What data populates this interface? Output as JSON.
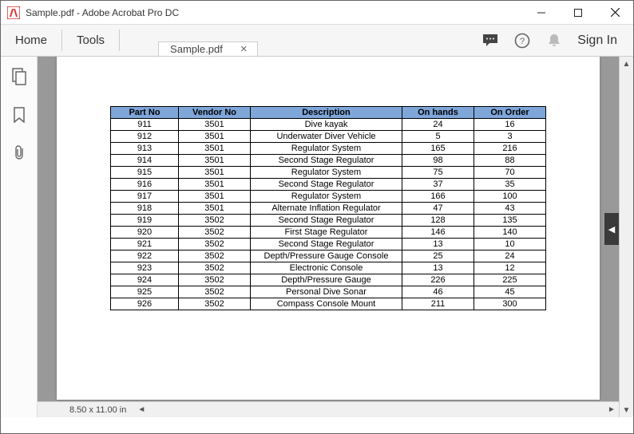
{
  "window": {
    "title": "Sample.pdf - Adobe Acrobat Pro DC"
  },
  "toolbar": {
    "home": "Home",
    "tools": "Tools",
    "tab_label": "Sample.pdf",
    "signin": "Sign In"
  },
  "status": {
    "page_size": "8.50 x 11.00 in"
  },
  "table": {
    "headers": [
      "Part No",
      "Vendor No",
      "Description",
      "On hands",
      "On Order"
    ],
    "rows": [
      [
        "911",
        "3501",
        "Dive kayak",
        "24",
        "16"
      ],
      [
        "912",
        "3501",
        "Underwater Diver Vehicle",
        "5",
        "3"
      ],
      [
        "913",
        "3501",
        "Regulator System",
        "165",
        "216"
      ],
      [
        "914",
        "3501",
        "Second Stage Regulator",
        "98",
        "88"
      ],
      [
        "915",
        "3501",
        "Regulator System",
        "75",
        "70"
      ],
      [
        "916",
        "3501",
        "Second Stage Regulator",
        "37",
        "35"
      ],
      [
        "917",
        "3501",
        "Regulator System",
        "166",
        "100"
      ],
      [
        "918",
        "3501",
        "Alternate Inflation Regulator",
        "47",
        "43"
      ],
      [
        "919",
        "3502",
        "Second Stage Regulator",
        "128",
        "135"
      ],
      [
        "920",
        "3502",
        "First Stage Regulator",
        "146",
        "140"
      ],
      [
        "921",
        "3502",
        "Second Stage Regulator",
        "13",
        "10"
      ],
      [
        "922",
        "3502",
        "Depth/Pressure Gauge Console",
        "25",
        "24"
      ],
      [
        "923",
        "3502",
        "Electronic Console",
        "13",
        "12"
      ],
      [
        "924",
        "3502",
        "Depth/Pressure Gauge",
        "226",
        "225"
      ],
      [
        "925",
        "3502",
        "Personal Dive Sonar",
        "46",
        "45"
      ],
      [
        "926",
        "3502",
        "Compass Console Mount",
        "211",
        "300"
      ]
    ]
  }
}
